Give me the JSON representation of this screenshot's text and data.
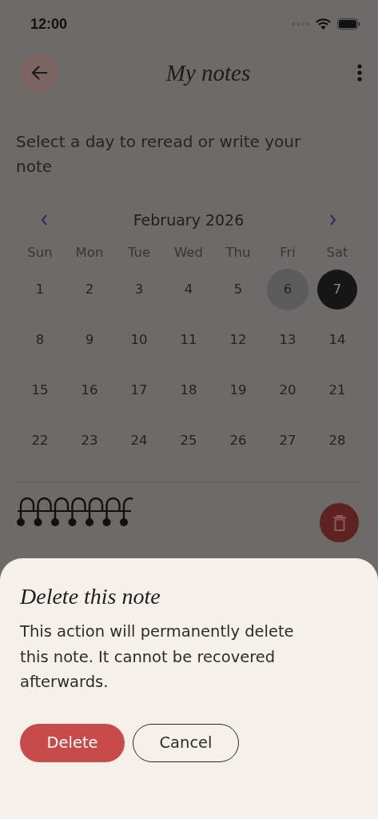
{
  "status_bar": {
    "time": "12:00"
  },
  "header": {
    "title": "My notes"
  },
  "intro": "Select a day to reread or write your note",
  "calendar": {
    "month": "February 2026",
    "weekdays": [
      "Sun",
      "Mon",
      "Tue",
      "Wed",
      "Thu",
      "Fri",
      "Sat"
    ],
    "weeks": [
      [
        {
          "day": "1",
          "selected": false,
          "has_note": false
        },
        {
          "day": "2",
          "selected": false,
          "has_note": false
        },
        {
          "day": "3",
          "selected": false,
          "has_note": false
        },
        {
          "day": "4",
          "selected": false,
          "has_note": false
        },
        {
          "day": "5",
          "selected": false,
          "has_note": false
        },
        {
          "day": "6",
          "selected": false,
          "has_note": true
        },
        {
          "day": "7",
          "selected": true,
          "has_note": false
        }
      ],
      [
        {
          "day": "8",
          "selected": false,
          "has_note": false
        },
        {
          "day": "9",
          "selected": false,
          "has_note": false
        },
        {
          "day": "10",
          "selected": false,
          "has_note": false
        },
        {
          "day": "11",
          "selected": false,
          "has_note": false
        },
        {
          "day": "12",
          "selected": false,
          "has_note": false
        },
        {
          "day": "13",
          "selected": false,
          "has_note": false
        },
        {
          "day": "14",
          "selected": false,
          "has_note": false
        }
      ],
      [
        {
          "day": "15",
          "selected": false,
          "has_note": false
        },
        {
          "day": "16",
          "selected": false,
          "has_note": false
        },
        {
          "day": "17",
          "selected": false,
          "has_note": false
        },
        {
          "day": "18",
          "selected": false,
          "has_note": false
        },
        {
          "day": "19",
          "selected": false,
          "has_note": false
        },
        {
          "day": "20",
          "selected": false,
          "has_note": false
        },
        {
          "day": "21",
          "selected": false,
          "has_note": false
        }
      ],
      [
        {
          "day": "22",
          "selected": false,
          "has_note": false
        },
        {
          "day": "23",
          "selected": false,
          "has_note": false
        },
        {
          "day": "24",
          "selected": false,
          "has_note": false
        },
        {
          "day": "25",
          "selected": false,
          "has_note": false
        },
        {
          "day": "26",
          "selected": false,
          "has_note": false
        },
        {
          "day": "27",
          "selected": false,
          "has_note": false
        },
        {
          "day": "28",
          "selected": false,
          "has_note": false
        }
      ]
    ]
  },
  "dialog": {
    "title": "Delete this note",
    "message": "This action will permanently delete this note. It cannot be recovered afterwards.",
    "buttons": [
      {
        "label": "Delete",
        "kind": "danger"
      },
      {
        "label": "Cancel",
        "kind": "outline"
      }
    ]
  }
}
